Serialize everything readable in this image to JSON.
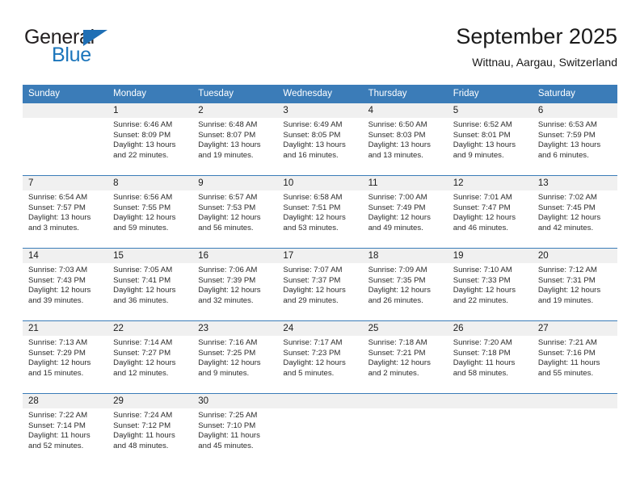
{
  "brand": {
    "line1": "General",
    "line2": "Blue",
    "triangle_color": "#1f6fb5",
    "line1_color": "#231f20",
    "line2_color": "#1b75bb"
  },
  "header": {
    "title": "September 2025",
    "subtitle": "Wittnau, Aargau, Switzerland"
  },
  "theme": {
    "header_blue": "#3b7cb8",
    "daynum_bg": "#f0f0f0",
    "text": "#1a1a1a"
  },
  "weekdays": [
    "Sunday",
    "Monday",
    "Tuesday",
    "Wednesday",
    "Thursday",
    "Friday",
    "Saturday"
  ],
  "weeks": [
    [
      {
        "day": "",
        "sunrise": "",
        "sunset": "",
        "daylight1": "",
        "daylight2": ""
      },
      {
        "day": "1",
        "sunrise": "Sunrise: 6:46 AM",
        "sunset": "Sunset: 8:09 PM",
        "daylight1": "Daylight: 13 hours",
        "daylight2": "and 22 minutes."
      },
      {
        "day": "2",
        "sunrise": "Sunrise: 6:48 AM",
        "sunset": "Sunset: 8:07 PM",
        "daylight1": "Daylight: 13 hours",
        "daylight2": "and 19 minutes."
      },
      {
        "day": "3",
        "sunrise": "Sunrise: 6:49 AM",
        "sunset": "Sunset: 8:05 PM",
        "daylight1": "Daylight: 13 hours",
        "daylight2": "and 16 minutes."
      },
      {
        "day": "4",
        "sunrise": "Sunrise: 6:50 AM",
        "sunset": "Sunset: 8:03 PM",
        "daylight1": "Daylight: 13 hours",
        "daylight2": "and 13 minutes."
      },
      {
        "day": "5",
        "sunrise": "Sunrise: 6:52 AM",
        "sunset": "Sunset: 8:01 PM",
        "daylight1": "Daylight: 13 hours",
        "daylight2": "and 9 minutes."
      },
      {
        "day": "6",
        "sunrise": "Sunrise: 6:53 AM",
        "sunset": "Sunset: 7:59 PM",
        "daylight1": "Daylight: 13 hours",
        "daylight2": "and 6 minutes."
      }
    ],
    [
      {
        "day": "7",
        "sunrise": "Sunrise: 6:54 AM",
        "sunset": "Sunset: 7:57 PM",
        "daylight1": "Daylight: 13 hours",
        "daylight2": "and 3 minutes."
      },
      {
        "day": "8",
        "sunrise": "Sunrise: 6:56 AM",
        "sunset": "Sunset: 7:55 PM",
        "daylight1": "Daylight: 12 hours",
        "daylight2": "and 59 minutes."
      },
      {
        "day": "9",
        "sunrise": "Sunrise: 6:57 AM",
        "sunset": "Sunset: 7:53 PM",
        "daylight1": "Daylight: 12 hours",
        "daylight2": "and 56 minutes."
      },
      {
        "day": "10",
        "sunrise": "Sunrise: 6:58 AM",
        "sunset": "Sunset: 7:51 PM",
        "daylight1": "Daylight: 12 hours",
        "daylight2": "and 53 minutes."
      },
      {
        "day": "11",
        "sunrise": "Sunrise: 7:00 AM",
        "sunset": "Sunset: 7:49 PM",
        "daylight1": "Daylight: 12 hours",
        "daylight2": "and 49 minutes."
      },
      {
        "day": "12",
        "sunrise": "Sunrise: 7:01 AM",
        "sunset": "Sunset: 7:47 PM",
        "daylight1": "Daylight: 12 hours",
        "daylight2": "and 46 minutes."
      },
      {
        "day": "13",
        "sunrise": "Sunrise: 7:02 AM",
        "sunset": "Sunset: 7:45 PM",
        "daylight1": "Daylight: 12 hours",
        "daylight2": "and 42 minutes."
      }
    ],
    [
      {
        "day": "14",
        "sunrise": "Sunrise: 7:03 AM",
        "sunset": "Sunset: 7:43 PM",
        "daylight1": "Daylight: 12 hours",
        "daylight2": "and 39 minutes."
      },
      {
        "day": "15",
        "sunrise": "Sunrise: 7:05 AM",
        "sunset": "Sunset: 7:41 PM",
        "daylight1": "Daylight: 12 hours",
        "daylight2": "and 36 minutes."
      },
      {
        "day": "16",
        "sunrise": "Sunrise: 7:06 AM",
        "sunset": "Sunset: 7:39 PM",
        "daylight1": "Daylight: 12 hours",
        "daylight2": "and 32 minutes."
      },
      {
        "day": "17",
        "sunrise": "Sunrise: 7:07 AM",
        "sunset": "Sunset: 7:37 PM",
        "daylight1": "Daylight: 12 hours",
        "daylight2": "and 29 minutes."
      },
      {
        "day": "18",
        "sunrise": "Sunrise: 7:09 AM",
        "sunset": "Sunset: 7:35 PM",
        "daylight1": "Daylight: 12 hours",
        "daylight2": "and 26 minutes."
      },
      {
        "day": "19",
        "sunrise": "Sunrise: 7:10 AM",
        "sunset": "Sunset: 7:33 PM",
        "daylight1": "Daylight: 12 hours",
        "daylight2": "and 22 minutes."
      },
      {
        "day": "20",
        "sunrise": "Sunrise: 7:12 AM",
        "sunset": "Sunset: 7:31 PM",
        "daylight1": "Daylight: 12 hours",
        "daylight2": "and 19 minutes."
      }
    ],
    [
      {
        "day": "21",
        "sunrise": "Sunrise: 7:13 AM",
        "sunset": "Sunset: 7:29 PM",
        "daylight1": "Daylight: 12 hours",
        "daylight2": "and 15 minutes."
      },
      {
        "day": "22",
        "sunrise": "Sunrise: 7:14 AM",
        "sunset": "Sunset: 7:27 PM",
        "daylight1": "Daylight: 12 hours",
        "daylight2": "and 12 minutes."
      },
      {
        "day": "23",
        "sunrise": "Sunrise: 7:16 AM",
        "sunset": "Sunset: 7:25 PM",
        "daylight1": "Daylight: 12 hours",
        "daylight2": "and 9 minutes."
      },
      {
        "day": "24",
        "sunrise": "Sunrise: 7:17 AM",
        "sunset": "Sunset: 7:23 PM",
        "daylight1": "Daylight: 12 hours",
        "daylight2": "and 5 minutes."
      },
      {
        "day": "25",
        "sunrise": "Sunrise: 7:18 AM",
        "sunset": "Sunset: 7:21 PM",
        "daylight1": "Daylight: 12 hours",
        "daylight2": "and 2 minutes."
      },
      {
        "day": "26",
        "sunrise": "Sunrise: 7:20 AM",
        "sunset": "Sunset: 7:18 PM",
        "daylight1": "Daylight: 11 hours",
        "daylight2": "and 58 minutes."
      },
      {
        "day": "27",
        "sunrise": "Sunrise: 7:21 AM",
        "sunset": "Sunset: 7:16 PM",
        "daylight1": "Daylight: 11 hours",
        "daylight2": "and 55 minutes."
      }
    ],
    [
      {
        "day": "28",
        "sunrise": "Sunrise: 7:22 AM",
        "sunset": "Sunset: 7:14 PM",
        "daylight1": "Daylight: 11 hours",
        "daylight2": "and 52 minutes."
      },
      {
        "day": "29",
        "sunrise": "Sunrise: 7:24 AM",
        "sunset": "Sunset: 7:12 PM",
        "daylight1": "Daylight: 11 hours",
        "daylight2": "and 48 minutes."
      },
      {
        "day": "30",
        "sunrise": "Sunrise: 7:25 AM",
        "sunset": "Sunset: 7:10 PM",
        "daylight1": "Daylight: 11 hours",
        "daylight2": "and 45 minutes."
      },
      {
        "day": "",
        "sunrise": "",
        "sunset": "",
        "daylight1": "",
        "daylight2": ""
      },
      {
        "day": "",
        "sunrise": "",
        "sunset": "",
        "daylight1": "",
        "daylight2": ""
      },
      {
        "day": "",
        "sunrise": "",
        "sunset": "",
        "daylight1": "",
        "daylight2": ""
      },
      {
        "day": "",
        "sunrise": "",
        "sunset": "",
        "daylight1": "",
        "daylight2": ""
      }
    ]
  ]
}
